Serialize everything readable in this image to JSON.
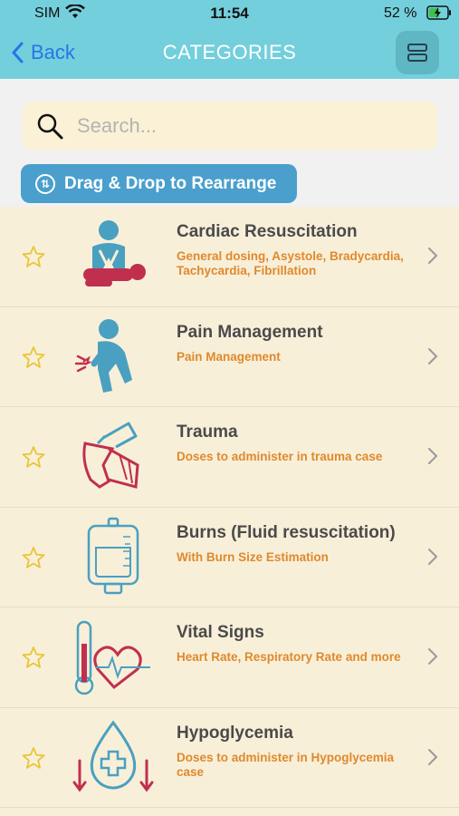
{
  "status_bar": {
    "carrier": "SIM",
    "time": "11:54",
    "battery": "52 %"
  },
  "nav": {
    "back_label": "Back",
    "title": "CATEGORIES",
    "layout_icon": "list-layout-icon"
  },
  "search": {
    "placeholder": "Search..."
  },
  "drag_button": {
    "label": "Drag & Drop to Rearrange"
  },
  "colors": {
    "nav_bg": "#74cfdc",
    "accent_orange": "#e0892c",
    "button_blue": "#4a9fcc",
    "star": "#e8c637"
  },
  "categories": [
    {
      "title": "Cardiac Resuscitation",
      "subtitle": "General dosing, Asystole, Bradycardia, Tachycardia, Fibrillation",
      "icon": "cpr-icon"
    },
    {
      "title": "Pain Management",
      "subtitle": "Pain Management",
      "icon": "pain-icon"
    },
    {
      "title": "Trauma",
      "subtitle": "Doses to administer in trauma case",
      "icon": "trauma-icon"
    },
    {
      "title": "Burns (Fluid resuscitation)",
      "subtitle": "With Burn Size Estimation",
      "icon": "iv-bag-icon"
    },
    {
      "title": "Vital Signs",
      "subtitle": "Heart Rate, Respiratory Rate and more",
      "icon": "vital-signs-icon"
    },
    {
      "title": "Hypoglycemia",
      "subtitle": "Doses to administer in Hypoglycemia case",
      "icon": "glucose-drop-icon"
    }
  ]
}
